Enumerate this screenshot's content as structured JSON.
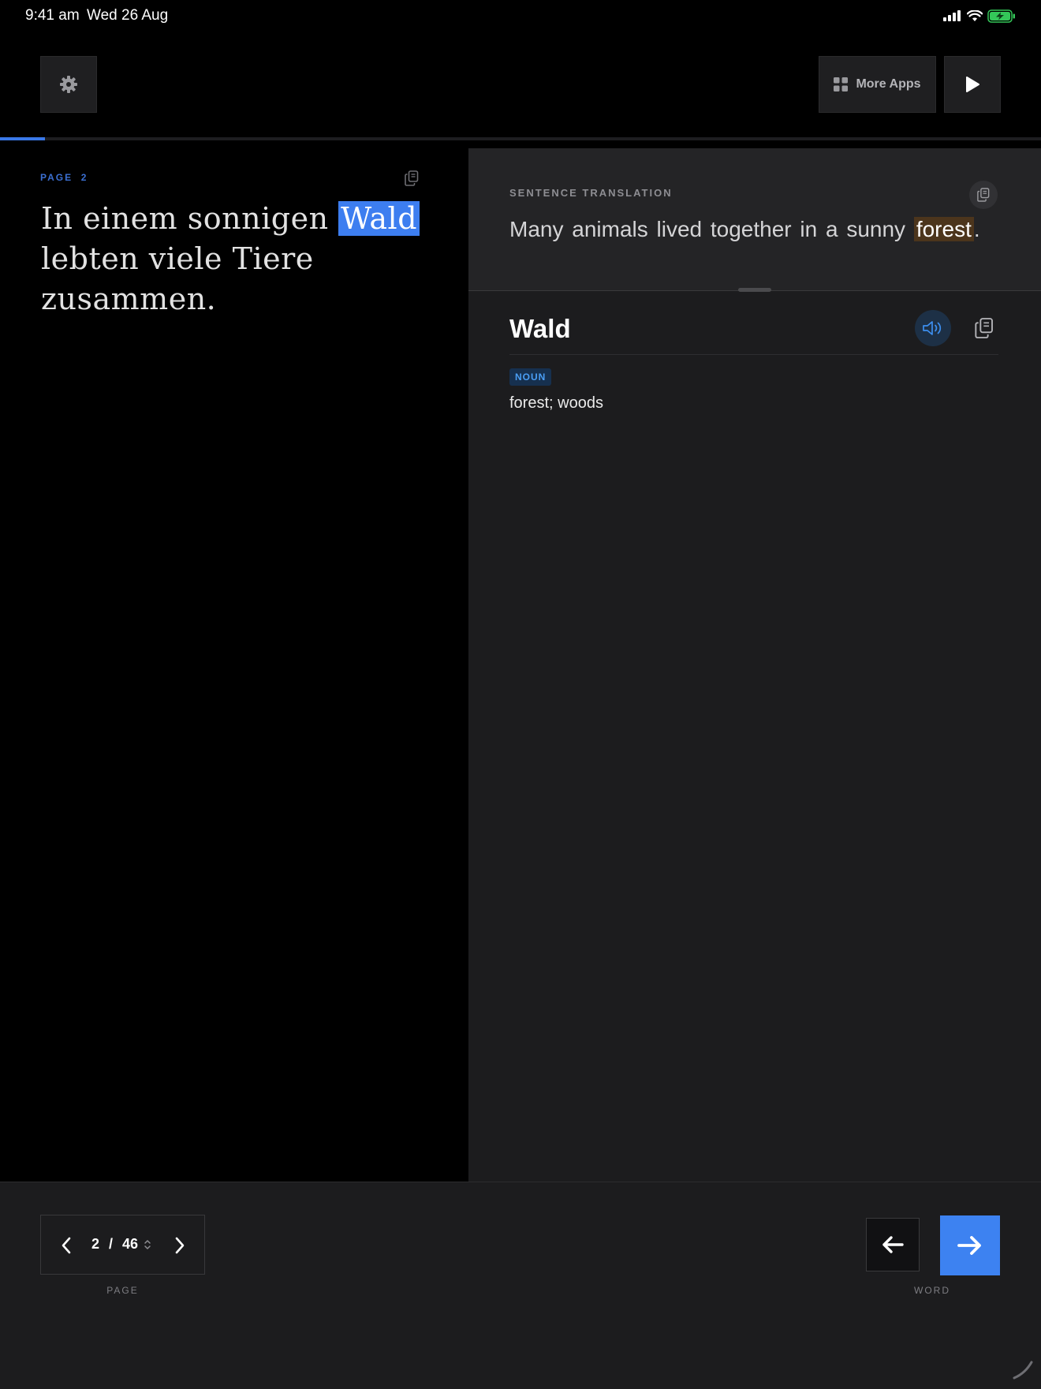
{
  "status_bar": {
    "time": "9:41 am",
    "date": "Wed 26 Aug",
    "battery_color": "#34c759"
  },
  "toolbar": {
    "settings_icon": "gear-icon",
    "more_apps_label": "More Apps",
    "more_apps_icon": "grid-icon",
    "play_icon": "play-icon"
  },
  "progress": {
    "fraction": 0.0435,
    "color": "#3a78e8"
  },
  "reader": {
    "page_label": "PAGE  2",
    "text_before": "In einem sonnigen ",
    "highlighted_word": "Wald",
    "text_after": " lebten viele Tiere zusammen.",
    "highlight_color": "#3d7ef0"
  },
  "translation": {
    "section_label": "SENTENCE TRANSLATION",
    "text_before": "Many animals lived together in a sunny ",
    "highlighted_word": "forest",
    "text_after": ".",
    "highlight_color": "#4c351c"
  },
  "word": {
    "title": "Wald",
    "part_of_speech": "NOUN",
    "definition": "forest; woods",
    "accent_color": "#4a9ef5"
  },
  "bottom": {
    "current_page": "2",
    "separator": "/",
    "total_pages": "46",
    "page_caption": "PAGE",
    "word_caption": "WORD",
    "accent_color": "#3d82f1"
  }
}
